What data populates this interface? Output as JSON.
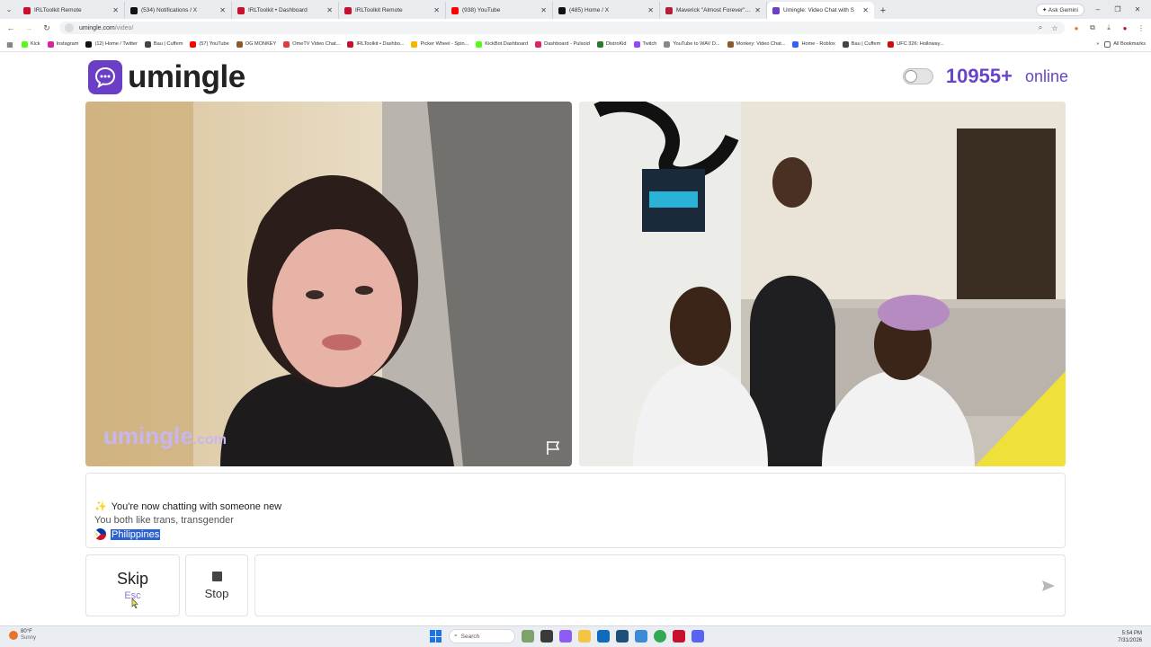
{
  "browser": {
    "tabs": [
      {
        "label": "IRLToolkit Remote",
        "color": "#c8102e",
        "active": false
      },
      {
        "label": "(534) Notifications / X",
        "color": "#111111",
        "active": false
      },
      {
        "label": "IRLToolkit • Dashboard",
        "color": "#c8102e",
        "active": false
      },
      {
        "label": "IRLToolkit Remote",
        "color": "#c8102e",
        "active": false
      },
      {
        "label": "(938) YouTube",
        "color": "#ff0000",
        "active": false
      },
      {
        "label": "(485) Home / X",
        "color": "#111111",
        "active": false
      },
      {
        "label": "Maverick \"Almost Forever\" EP",
        "color": "#b0203a",
        "active": false
      },
      {
        "label": "Umingle: Video Chat with S",
        "color": "#6a3fc6",
        "active": true
      }
    ],
    "ask_gemini": "Ask Gemini",
    "url_host": "umingle.com",
    "url_path": "/video/",
    "bookmarks": [
      {
        "label": "Kick",
        "color": "#53fc18"
      },
      {
        "label": "Instagram",
        "color": "#d6249f"
      },
      {
        "label": "(12) Home / Twitter",
        "color": "#111111"
      },
      {
        "label": "Bau | Cuffem",
        "color": "#444444"
      },
      {
        "label": "(57) YouTube",
        "color": "#ff0000"
      },
      {
        "label": "OG MONKEY",
        "color": "#8b5a2b"
      },
      {
        "label": "OmeTV Video Chat...",
        "color": "#e23b3b"
      },
      {
        "label": "IRLToolkit • Dashbo...",
        "color": "#c8102e"
      },
      {
        "label": "Picker Wheel - Spin...",
        "color": "#f4b400"
      },
      {
        "label": "KickBot Dashboard",
        "color": "#53fc18"
      },
      {
        "label": "Dashboard - Pulsoid",
        "color": "#e0245e"
      },
      {
        "label": "DistroKid",
        "color": "#2d7a2d"
      },
      {
        "label": "Twitch",
        "color": "#9146ff"
      },
      {
        "label": "YouTube to WAV D...",
        "color": "#888888"
      },
      {
        "label": "Monkey: Video Chat...",
        "color": "#8b5a2b"
      },
      {
        "label": "Home - Roblox",
        "color": "#335fff"
      },
      {
        "label": "Bau | Cuffem",
        "color": "#444444"
      },
      {
        "label": "UFC 326: Holloway...",
        "color": "#d20a0a"
      }
    ],
    "all_bookmarks": "All Bookmarks"
  },
  "site": {
    "logo_text": "umingle",
    "online_count": "10955+",
    "online_label": "online",
    "accent_color": "#6a44c8",
    "watermark": "umingle",
    "watermark_domain": ".com"
  },
  "chat": {
    "line1": "You're now chatting with someone new",
    "line2": "You both like trans, transgender",
    "country": "Philippines"
  },
  "controls": {
    "skip_label": "Skip",
    "skip_key": "Esc",
    "stop_label": "Stop",
    "message_placeholder": ""
  },
  "taskbar": {
    "temp": "80°F",
    "weather": "Sunny",
    "search_label": "Search",
    "time": "5:54 PM",
    "date": "7/31/2026"
  }
}
